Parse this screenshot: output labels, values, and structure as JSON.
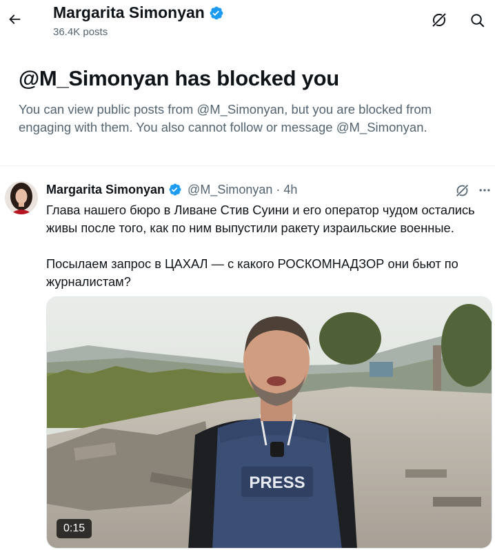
{
  "header": {
    "name": "Margarita Simonyan",
    "posts_count": "36.4K posts"
  },
  "blocked": {
    "title": "@M_Simonyan has blocked you",
    "description": "You can view public posts from @M_Simonyan, but you are blocked from engaging with them. You also cannot follow or message @M_Simonyan."
  },
  "tweet": {
    "author_name": "Margarita Simonyan",
    "handle": "@M_Simonyan",
    "separator": "·",
    "time": "4h",
    "text_line1": "Глава нашего бюро в Ливане Стив Суини и его оператор чудом остались живы после того, как по ним выпустили ракету израильские военные.",
    "text_line2": "Посылаем запрос в ЦАХАЛ — с какого РОСКОМНАДЗОР они бьют по журналистам?",
    "video_duration": "0:15",
    "vest_label": "PRESS"
  },
  "icons": {
    "back": "arrow-left-icon",
    "grok": "grok-icon",
    "search": "search-icon",
    "verified": "verified-badge-icon",
    "more": "more-dots-icon"
  },
  "colors": {
    "verified_blue": "#1d9bf0",
    "text_secondary": "#536471"
  }
}
